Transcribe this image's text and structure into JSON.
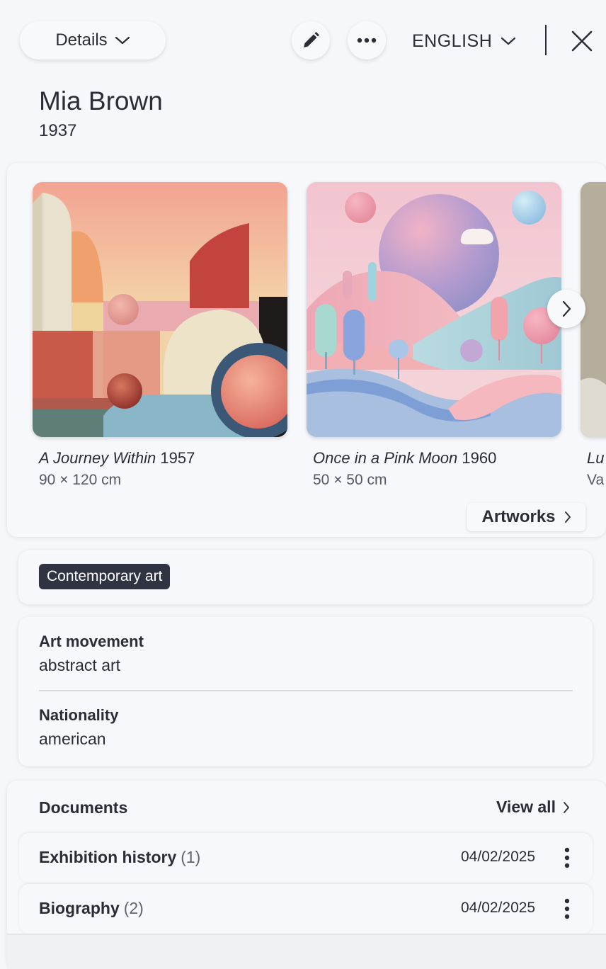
{
  "toolbar": {
    "view_label": "Details",
    "language_label": "ENGLISH",
    "edit_icon": "pencil-icon",
    "more_icon": "more-horizontal-icon",
    "close_icon": "close-icon"
  },
  "artist": {
    "name": "Mia Brown",
    "birth_year": "1937"
  },
  "artworks": {
    "items": [
      {
        "title": "A Journey Within",
        "year": "1957",
        "dimensions": "90 × 120 cm"
      },
      {
        "title": "Once in a Pink Moon",
        "year": "1960",
        "dimensions": "50 × 50 cm"
      },
      {
        "title": "Lu",
        "year": "",
        "dimensions": "Va"
      }
    ],
    "link_label": "Artworks"
  },
  "tags": [
    "Contemporary art"
  ],
  "details": {
    "art_movement_label": "Art movement",
    "art_movement_value": "abstract art",
    "nationality_label": "Nationality",
    "nationality_value": "american"
  },
  "documents": {
    "title": "Documents",
    "view_all_label": "View all",
    "rows": [
      {
        "name": "Exhibition history",
        "count": "(1)",
        "date": "04/02/2025"
      },
      {
        "name": "Biography",
        "count": "(2)",
        "date": "04/02/2025"
      }
    ]
  },
  "colors": {
    "background": "#f6f7fa",
    "text": "#2b2d36",
    "tag_bg": "#2f3342"
  }
}
